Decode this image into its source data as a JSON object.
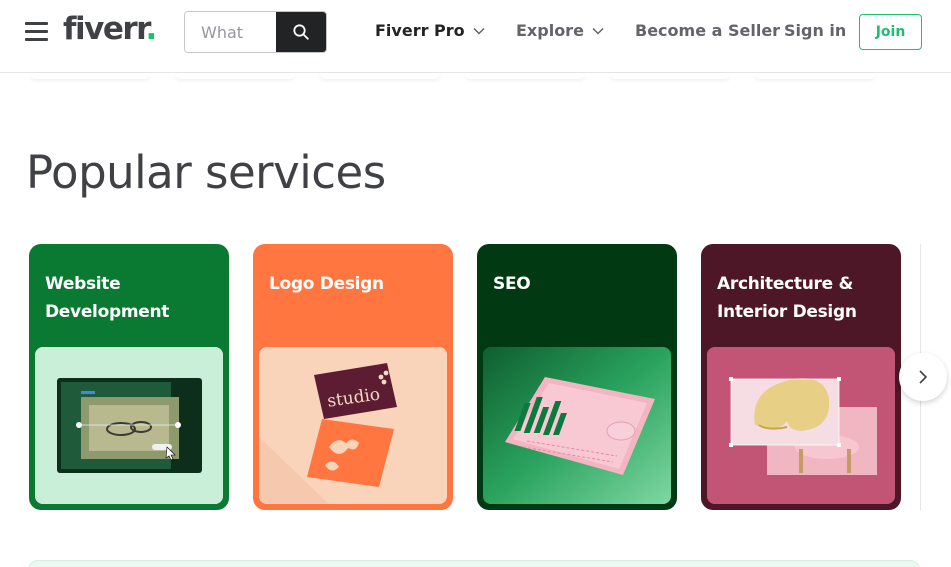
{
  "header": {
    "logo_text": "fiverr",
    "logo_dot": ".",
    "search_placeholder": "What",
    "nav": {
      "pro_label": "Fiverr Pro",
      "explore_label": "Explore",
      "seller_label": "Become a Seller",
      "signin_label": "Sign in",
      "join_label": "Join"
    },
    "icons": {
      "menu": "hamburger-menu-icon",
      "search": "search-icon",
      "dropdown": "chevron-down-icon"
    }
  },
  "main": {
    "section_title": "Popular services",
    "cards": [
      {
        "title": "Website Development",
        "bg": "#0a7a32",
        "img_bg": "#c9efd9"
      },
      {
        "title": "Logo Design",
        "bg": "#ff7640",
        "img_bg": "#f9d4bb"
      },
      {
        "title": "SEO",
        "bg": "#003912",
        "img_bg": "#1f8a4c"
      },
      {
        "title": "Architecture & Interior Design",
        "bg": "#4d1727",
        "img_bg": "#c25476"
      }
    ],
    "next_icon": "chevron-right-icon"
  },
  "colors": {
    "brand_green": "#1dbf73",
    "text_dark": "#404145",
    "search_btn": "#222325"
  }
}
